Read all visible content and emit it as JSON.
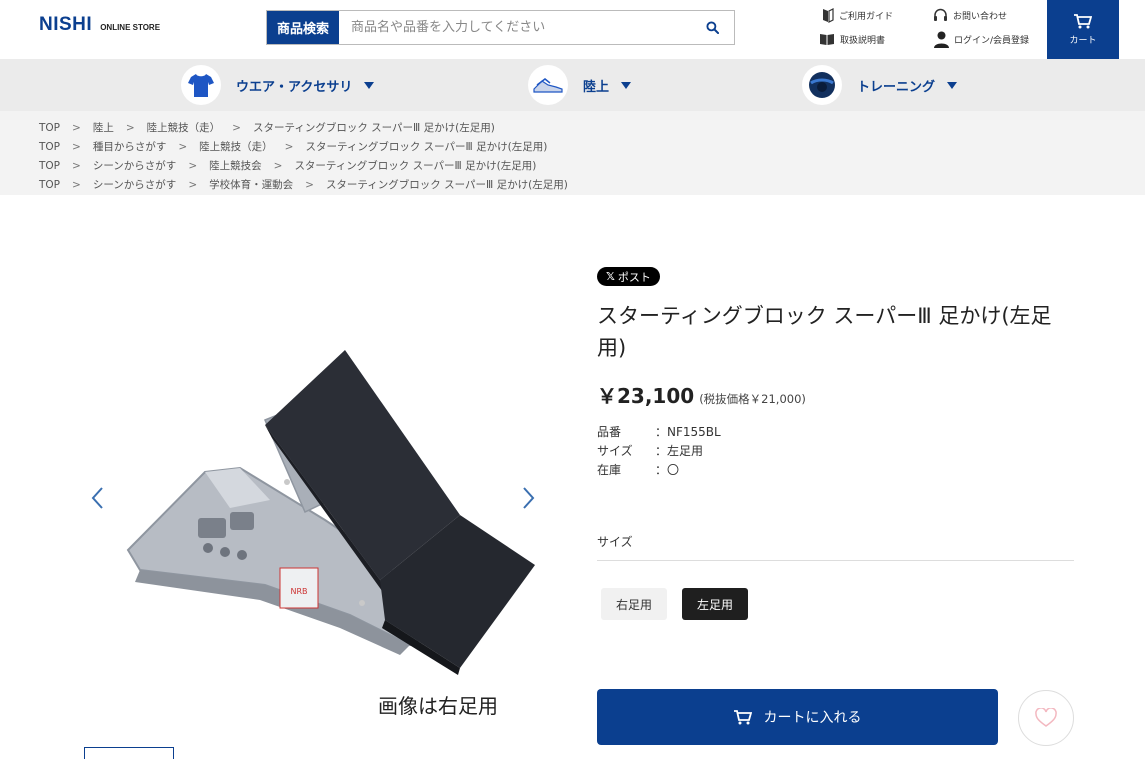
{
  "header": {
    "logo_main": "NISHI",
    "logo_sub": "ONLINE STORE",
    "search_label": "商品検索",
    "search_placeholder": "商品名や品番を入力してください",
    "links": {
      "guide": "ご利用ガイド",
      "contact": "お問い合わせ",
      "manual": "取扱説明書",
      "login": "ログイン/会員登録"
    },
    "cart_label": "カート"
  },
  "categories": [
    {
      "label": "ウエア・アクセサリ",
      "icon": "shirt-icon"
    },
    {
      "label": "陸上",
      "icon": "spikes-icon"
    },
    {
      "label": "トレーニング",
      "icon": "ball-icon"
    }
  ],
  "breadcrumbs": [
    [
      "TOP",
      "陸上",
      "陸上競技（走）",
      "スターティングブロック スーパーⅢ 足かけ(左足用)"
    ],
    [
      "TOP",
      "種目からさがす",
      "陸上競技（走）",
      "スターティングブロック スーパーⅢ 足かけ(左足用)"
    ],
    [
      "TOP",
      "シーンからさがす",
      "陸上競技会",
      "スターティングブロック スーパーⅢ 足かけ(左足用)"
    ],
    [
      "TOP",
      "シーンからさがす",
      "学校体育・運動会",
      "スターティングブロック スーパーⅢ 足かけ(左足用)"
    ]
  ],
  "gallery": {
    "caption": "画像は右足用",
    "plate_text": "NRB"
  },
  "product": {
    "share_label": "ポスト",
    "title": "スターティングブロック スーパーⅢ 足かけ(左足用)",
    "price": "￥23,100",
    "price_tax": "(税抜価格￥21,000)",
    "specs": [
      {
        "key": "品番",
        "sep": "：",
        "value": "NF155BL"
      },
      {
        "key": "サイズ",
        "sep": "：",
        "value": "左足用"
      },
      {
        "key": "在庫",
        "sep": "：",
        "value": "〇"
      }
    ],
    "size_label": "サイズ",
    "size_options": [
      "右足用",
      "左足用"
    ],
    "selected_size": "左足用",
    "add_to_cart": "カートに入れる"
  },
  "colors": {
    "brand": "#0b3f8f",
    "selected_option": "#1f1f1f"
  }
}
